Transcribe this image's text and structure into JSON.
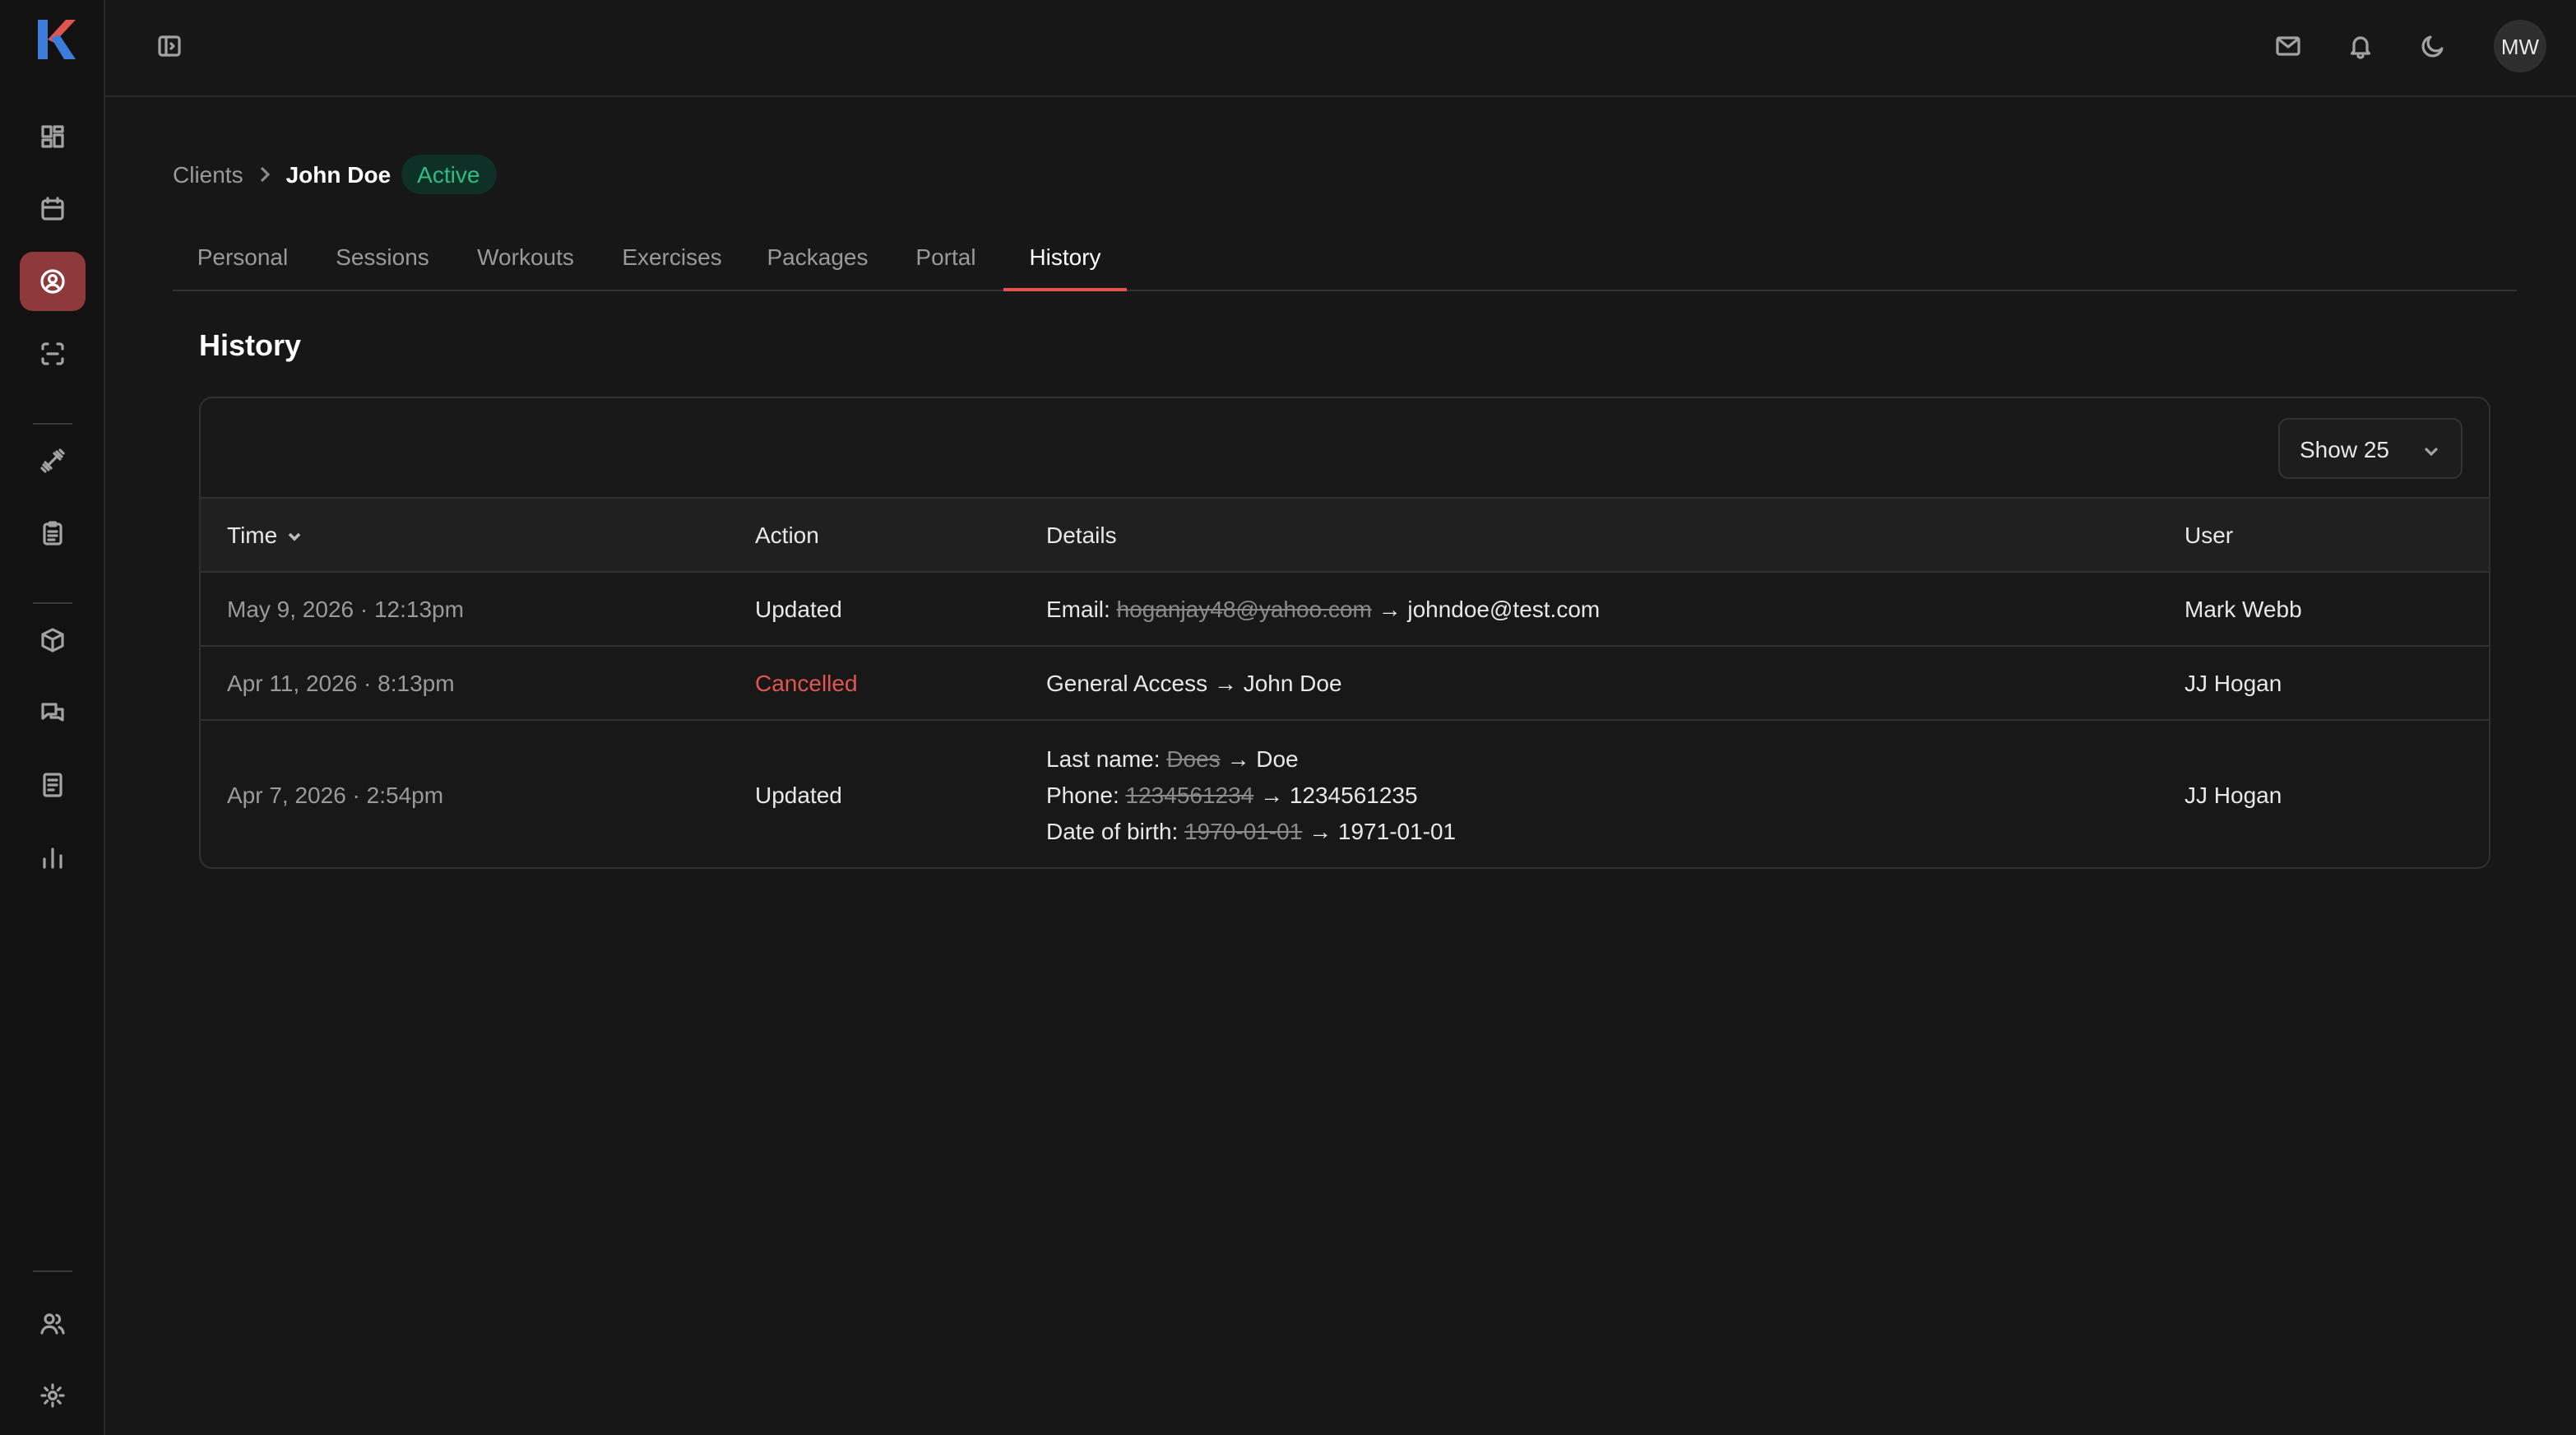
{
  "topbar": {
    "avatar_initials": "MW"
  },
  "breadcrumb": {
    "parent": "Clients",
    "current": "John Doe",
    "status": "Active"
  },
  "tabs": [
    {
      "label": "Personal"
    },
    {
      "label": "Sessions"
    },
    {
      "label": "Workouts"
    },
    {
      "label": "Exercises"
    },
    {
      "label": "Packages"
    },
    {
      "label": "Portal"
    },
    {
      "label": "History"
    }
  ],
  "active_tab": "History",
  "section": {
    "title": "History"
  },
  "table": {
    "page_size_label": "Show 25",
    "headers": {
      "time": "Time",
      "action": "Action",
      "details": "Details",
      "user": "User"
    },
    "rows": [
      {
        "time": "May 9, 2026 · 12:13pm",
        "action": "Updated",
        "details": [
          {
            "label": "Email:",
            "old": "hoganjay48@yahoo.com",
            "arrow": "→",
            "new": "johndoe@test.com"
          }
        ],
        "user": "Mark Webb"
      },
      {
        "time": "Apr 11, 2026 · 8:13pm",
        "action": "Cancelled",
        "details": [
          {
            "label": "General Access",
            "old": "",
            "arrow": "→",
            "new": "John Doe"
          }
        ],
        "user": "JJ Hogan"
      },
      {
        "time": "Apr 7, 2026 · 2:54pm",
        "action": "Updated",
        "details": [
          {
            "label": "Last name:",
            "old": "Does",
            "arrow": "→",
            "new": "Doe"
          },
          {
            "label": "Phone:",
            "old": "1234561234",
            "arrow": "→",
            "new": "1234561235"
          },
          {
            "label": "Date of birth:",
            "old": "1970-01-01",
            "arrow": "→",
            "new": "1971-01-01"
          }
        ],
        "user": "JJ Hogan"
      }
    ]
  },
  "colors": {
    "accent": "#e0554f",
    "active_nav": "#8e3a3a",
    "status_green": "#2dbd82",
    "background": "#171717"
  }
}
